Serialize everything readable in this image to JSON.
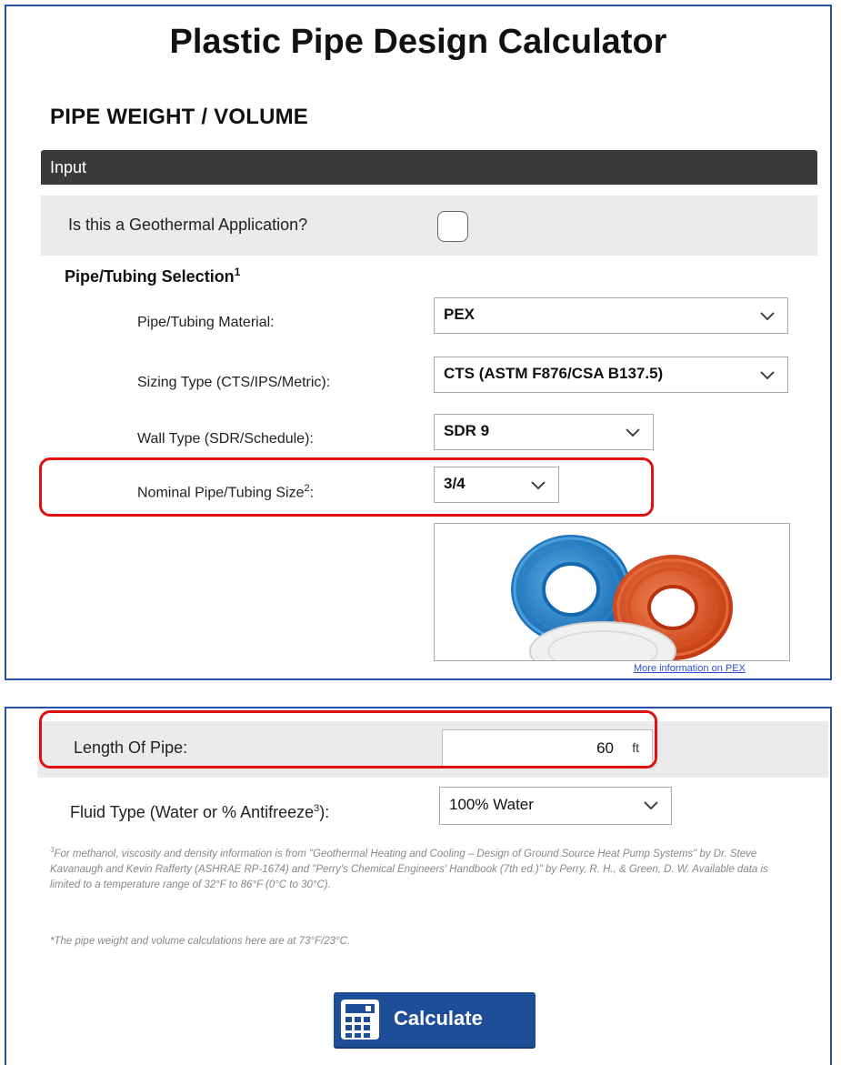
{
  "app": {
    "title": "Plastic Pipe Design Calculator",
    "section_title": "PIPE WEIGHT / VOLUME",
    "input_header": "Input"
  },
  "geothermal": {
    "label": "Is this a Geothermal Application?",
    "checked": false
  },
  "selection": {
    "heading": "Pipe/Tubing Selection",
    "heading_sup": "1",
    "material": {
      "label": "Pipe/Tubing Material:",
      "value": "PEX"
    },
    "sizing": {
      "label": "Sizing Type (CTS/IPS/Metric):",
      "value": "CTS (ASTM F876/CSA B137.5)"
    },
    "wall": {
      "label": "Wall Type (SDR/Schedule):",
      "value": "SDR 9"
    },
    "nominal": {
      "label": "Nominal Pipe/Tubing Size",
      "label_sup": "2",
      "label_end": ":",
      "value": "3/4"
    },
    "more_link": "More information on PEX"
  },
  "length": {
    "label": "Length Of Pipe:",
    "value": "60",
    "unit": "ft"
  },
  "fluid": {
    "label_start": "Fluid Type (Water or % Antifreeze",
    "label_sup": "3",
    "label_end": "):",
    "value": "100% Water"
  },
  "notes": {
    "footnote_sup": "3",
    "footnote": "For methanol, viscosity and density information is from \"Geothermal Heating and Cooling – Design of Ground Source Heat Pump Systems\" by Dr. Steve Kavanaugh and Kevin Rafferty (ASHRAE RP-1674) and \"Perry's Chemical Engineers' Handbook (7th ed.)\" by Perry, R. H., & Green, D. W. Available data is limited to a temperature range of 32°F to 86°F (0°C to 30°C).",
    "temp_note": "*The pipe weight and volume calculations here are at 73°F/23°C."
  },
  "calculate": {
    "label": "Calculate"
  },
  "colors": {
    "border": "#2550a8",
    "highlight": "#e01010",
    "header_bar": "#3a3a3a",
    "button": "#1f4e98"
  }
}
